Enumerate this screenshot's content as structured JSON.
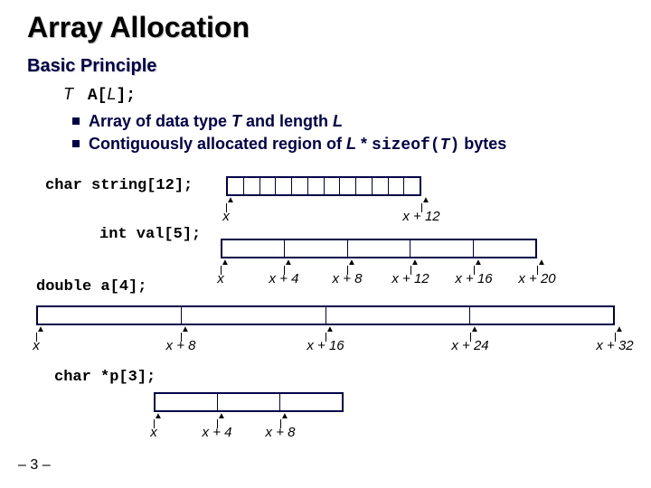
{
  "title": "Array Allocation",
  "subtitle": "Basic Principle",
  "decl": {
    "T": "T",
    "A": "A",
    "L": "L",
    "open": "[",
    "close": "];"
  },
  "bullets": {
    "b1a": "Array of data type ",
    "b1b": "T",
    "b1c": " and length ",
    "b1d": "L",
    "b2a": "Contiguously allocated region of ",
    "b2b": "L",
    "b2c": " * ",
    "b2d": "sizeof(",
    "b2e": "T",
    "b2f": ")",
    "b2g": " bytes"
  },
  "ex": {
    "string": "char string[12];",
    "val": "int val[5];",
    "a": "double a[4];",
    "p": "char *p[3];"
  },
  "ticks": {
    "x": "x",
    "x4": "x + 4",
    "x8": "x + 8",
    "x12": "x + 12",
    "x16": "x + 16",
    "x20": "x + 20",
    "x24": "x + 24",
    "x32": "x + 32"
  },
  "footer": "– 3 –"
}
